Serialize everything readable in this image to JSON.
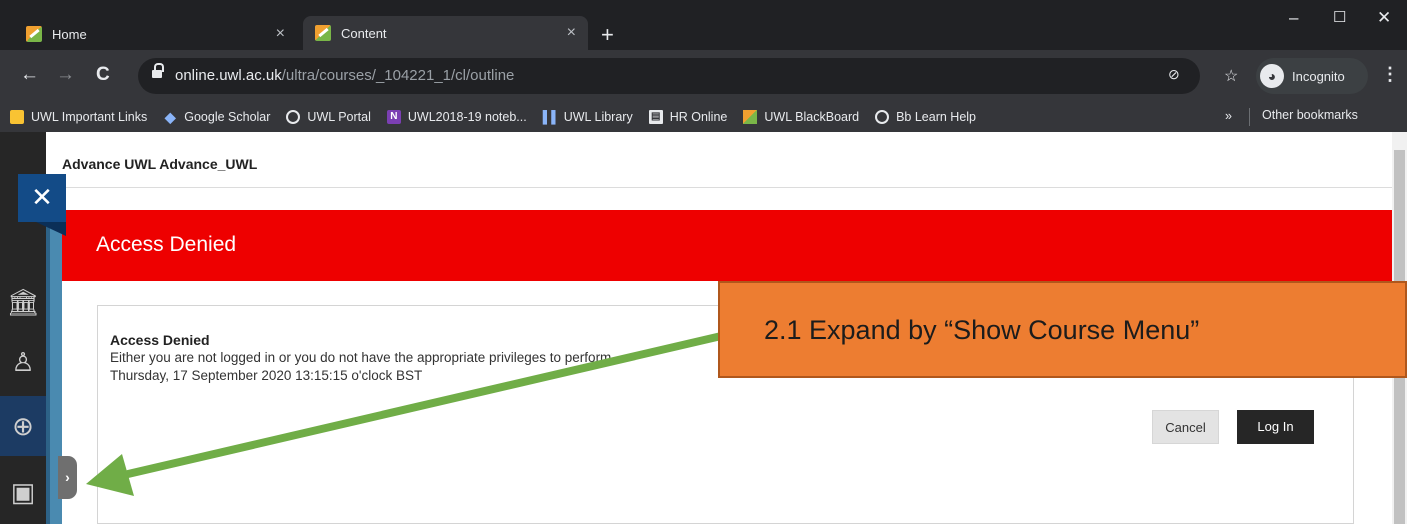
{
  "browser": {
    "tabs": [
      {
        "label": "Home",
        "close": "×"
      },
      {
        "label": "Content",
        "close": "×"
      }
    ],
    "new_tab": "+",
    "window_controls": {
      "minimize": "–",
      "maximize": "☐",
      "close": "✕"
    },
    "nav": {
      "back": "←",
      "forward": "→",
      "reload": "C"
    },
    "url": {
      "host": "online.uwl.ac.uk",
      "path": "/ultra/courses/_104221_1/cl/outline"
    },
    "incognito_label": "Incognito",
    "bookmarks": [
      {
        "label": "UWL Important Links",
        "icon": "folder-icon"
      },
      {
        "label": "Google Scholar",
        "icon": "scholar-icon"
      },
      {
        "label": "UWL Portal",
        "icon": "globe-icon"
      },
      {
        "label": "UWL2018-19 noteb...",
        "icon": "onenote-icon"
      },
      {
        "label": "UWL Library",
        "icon": "library-icon"
      },
      {
        "label": "HR Online",
        "icon": "hr-icon"
      },
      {
        "label": "UWL BlackBoard",
        "icon": "blackboard-icon"
      },
      {
        "label": "Bb Learn Help",
        "icon": "globe-icon"
      }
    ],
    "bookmarks_more": "»",
    "other_bookmarks": "Other bookmarks"
  },
  "page": {
    "course_name": "Advance UWL Advance_UWL",
    "banner_title": "Access Denied",
    "message": {
      "title": "Access Denied",
      "body": "Either you are not logged in or you do not have the appropriate privileges to perform",
      "timestamp": "Thursday, 17 September 2020 13:15:15 o'clock BST"
    },
    "buttons": {
      "cancel": "Cancel",
      "login": "Log In"
    },
    "close_symbol": "✕",
    "expand_symbol": "›"
  },
  "annotation": {
    "text": "2.1     Expand by “Show Course Menu”"
  },
  "colors": {
    "banner": "#ee0000",
    "callout": "#ed7d31",
    "arrow": "#70ad47"
  }
}
